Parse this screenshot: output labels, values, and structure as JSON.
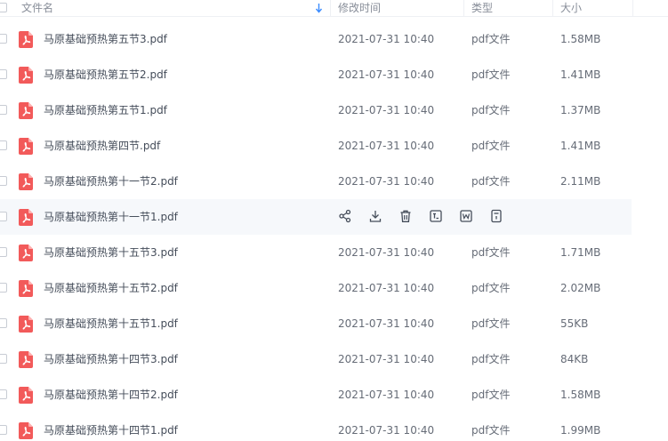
{
  "header": {
    "name_label": "文件名",
    "time_label": "修改时间",
    "type_label": "类型",
    "size_label": "大小"
  },
  "files": [
    {
      "name": "马原基础预热第五节3.pdf",
      "time": "2021-07-31 10:40",
      "type": "pdf文件",
      "size": "1.58MB"
    },
    {
      "name": "马原基础预热第五节2.pdf",
      "time": "2021-07-31 10:40",
      "type": "pdf文件",
      "size": "1.41MB"
    },
    {
      "name": "马原基础预热第五节1.pdf",
      "time": "2021-07-31 10:40",
      "type": "pdf文件",
      "size": "1.37MB"
    },
    {
      "name": "马原基础预热第四节.pdf",
      "time": "2021-07-31 10:40",
      "type": "pdf文件",
      "size": "1.41MB"
    },
    {
      "name": "马原基础预热第十一节2.pdf",
      "time": "2021-07-31 10:40",
      "type": "pdf文件",
      "size": "2.11MB"
    },
    {
      "name": "马原基础预热第十一节1.pdf",
      "time": "",
      "type": "",
      "size": ""
    },
    {
      "name": "马原基础预热第十五节3.pdf",
      "time": "2021-07-31 10:40",
      "type": "pdf文件",
      "size": "1.71MB"
    },
    {
      "name": "马原基础预热第十五节2.pdf",
      "time": "2021-07-31 10:40",
      "type": "pdf文件",
      "size": "2.02MB"
    },
    {
      "name": "马原基础预热第十五节1.pdf",
      "time": "2021-07-31 10:40",
      "type": "pdf文件",
      "size": "55KB"
    },
    {
      "name": "马原基础预热第十四节3.pdf",
      "time": "2021-07-31 10:40",
      "type": "pdf文件",
      "size": "84KB"
    },
    {
      "name": "马原基础预热第十四节2.pdf",
      "time": "2021-07-31 10:40",
      "type": "pdf文件",
      "size": "1.58MB"
    },
    {
      "name": "马原基础预热第十四节1.pdf",
      "time": "2021-07-31 10:40",
      "type": "pdf文件",
      "size": "1.99MB"
    }
  ],
  "hover_actions": [
    "share-icon",
    "download-icon",
    "delete-icon",
    "text-recognition-icon",
    "word-convert-icon",
    "more-icon"
  ],
  "colors": {
    "pdf_icon": "#f25a5a",
    "sort_arrow": "#3b8cff",
    "hover_row": "#f6f8fb"
  }
}
